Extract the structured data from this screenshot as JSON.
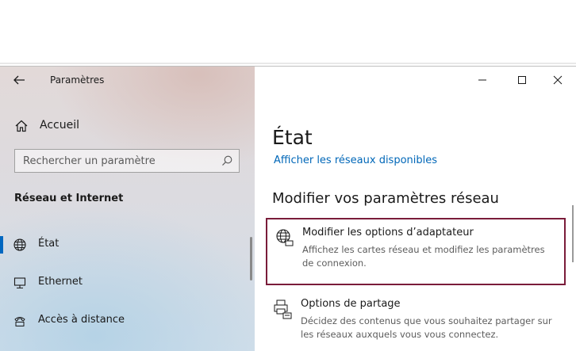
{
  "window": {
    "title": "Paramètres"
  },
  "sidebar": {
    "home_label": "Accueil",
    "search_placeholder": "Rechercher un paramètre",
    "section_title": "Réseau et Internet",
    "items": [
      {
        "label": "État",
        "icon": "globe-icon",
        "active": true
      },
      {
        "label": "Ethernet",
        "icon": "monitor-network-icon",
        "active": false
      },
      {
        "label": "Accès à distance",
        "icon": "phone-modem-icon",
        "active": false
      }
    ]
  },
  "content": {
    "title": "État",
    "link_label": "Afficher les réseaux disponibles",
    "heading": "Modifier vos paramètres réseau",
    "options": [
      {
        "title": "Modifier les options d’adaptateur",
        "description": "Affichez les cartes réseau et modifiez les paramètres de connexion.",
        "icon": "network-adapter-icon"
      },
      {
        "title": "Options de partage",
        "description": "Décidez des contenus que vous souhaitez partager sur les réseaux auxquels vous vous connectez.",
        "icon": "sharing-printer-icon"
      }
    ]
  },
  "colors": {
    "accent": "#0067c0",
    "link": "#0067b8",
    "highlight_border": "#7a1c3a"
  }
}
